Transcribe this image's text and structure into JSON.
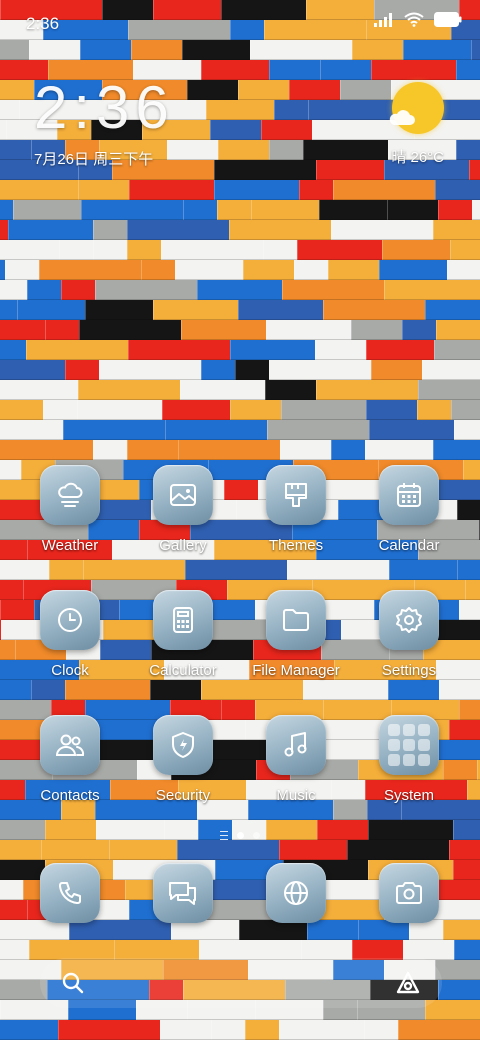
{
  "status_bar": {
    "time": "2:36",
    "icons": [
      "signal-icon",
      "wifi-icon",
      "battery-icon"
    ]
  },
  "clock_widget": {
    "time": "2:36",
    "date": "7月26日 周三下午"
  },
  "weather_widget": {
    "text": "晴 26°C",
    "icon": "sunny-cloud-icon"
  },
  "apps": [
    {
      "label": "Weather",
      "icon": "weather-cloud-icon"
    },
    {
      "label": "Gallery",
      "icon": "gallery-image-icon"
    },
    {
      "label": "Themes",
      "icon": "paintbrush-icon"
    },
    {
      "label": "Calendar",
      "icon": "calendar-icon"
    },
    {
      "label": "Clock",
      "icon": "clock-icon"
    },
    {
      "label": "Calculator",
      "icon": "calculator-icon"
    },
    {
      "label": "File Manager",
      "icon": "folder-icon"
    },
    {
      "label": "Settings",
      "icon": "gear-icon"
    },
    {
      "label": "Contacts",
      "icon": "contacts-icon"
    },
    {
      "label": "Security",
      "icon": "shield-icon"
    },
    {
      "label": "Music",
      "icon": "music-note-icon"
    },
    {
      "label": "System",
      "icon": "folder-grid-icon"
    }
  ],
  "page_indicator": {
    "pages": 2,
    "current": 1
  },
  "dock": [
    {
      "name": "phone",
      "icon": "phone-icon"
    },
    {
      "name": "messages",
      "icon": "message-icon"
    },
    {
      "name": "browser",
      "icon": "globe-icon"
    },
    {
      "name": "camera",
      "icon": "camera-icon"
    }
  ],
  "search_bar": {
    "left_icon": "search-icon",
    "right_icon": "assistant-icon"
  },
  "colors": {
    "icon_gradient_top": "#c6d7e1",
    "icon_gradient_bottom": "#6f8ea3",
    "sun": "#f7c72a",
    "brick_red": "#e8261d",
    "brick_blue": "#1f6fd1",
    "brick_yellow": "#f4ae3a",
    "brick_white": "#f3f3f1",
    "brick_black": "#151515"
  }
}
